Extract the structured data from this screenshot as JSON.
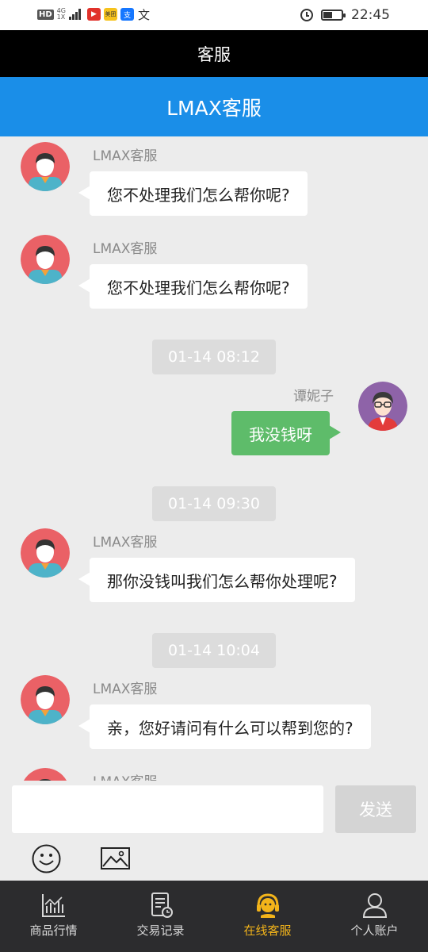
{
  "status_bar": {
    "network": "HD",
    "network_gen": "4G",
    "network_sub": "1X",
    "time": "22:45",
    "battery_percent": 50,
    "notification_icons": [
      "video-app-icon",
      "meituan-icon",
      "alipay-icon",
      "text-app-icon"
    ],
    "app_badge_texts": [
      "▶",
      "美团",
      "支",
      "文"
    ]
  },
  "header": {
    "title": "客服"
  },
  "chat_header": {
    "title": "LMAX客服"
  },
  "colors": {
    "title_bar": "#1a8ee8",
    "out_bubble": "#5ebc6a",
    "active_tab": "#f3b41a"
  },
  "messages": [
    {
      "sender": "LMAX客服",
      "text": "您不处理我们怎么帮你呢?"
    },
    {
      "sender": "LMAX客服",
      "text": "您不处理我们怎么帮你呢?"
    },
    {
      "timestamp": "01-14 08:12"
    },
    {
      "sender": "谭妮子",
      "text": "我没钱呀"
    },
    {
      "timestamp": "01-14 09:30"
    },
    {
      "sender": "LMAX客服",
      "text": "那你没钱叫我们怎么帮你处理呢?"
    },
    {
      "timestamp": "01-14 10:04"
    },
    {
      "sender": "LMAX客服",
      "text": "亲，您好请问有什么可以帮到您的?"
    },
    {
      "sender": "LMAX客服"
    }
  ],
  "input": {
    "value": "",
    "placeholder": "",
    "send_label": "发送"
  },
  "tabs": [
    {
      "label": "商品行情",
      "icon": "chart-icon"
    },
    {
      "label": "交易记录",
      "icon": "record-icon"
    },
    {
      "label": "在线客服",
      "icon": "headset-icon",
      "active": true
    },
    {
      "label": "个人账户",
      "icon": "user-icon"
    }
  ]
}
